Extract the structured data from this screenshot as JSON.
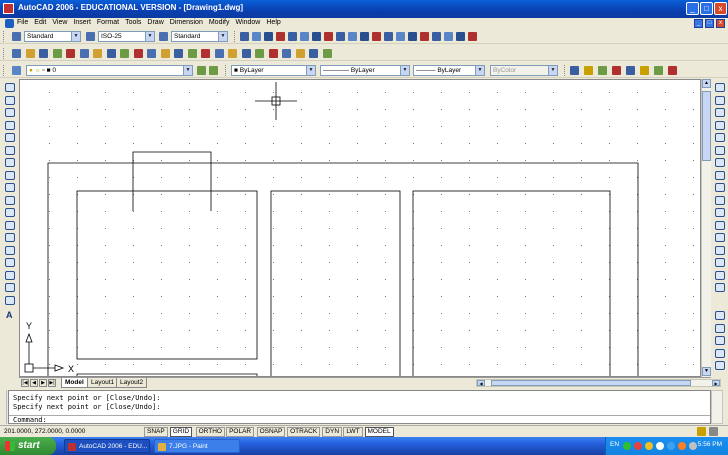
{
  "window": {
    "title": "AutoCAD 2006 - EDUCATIONAL VERSION - [Drawing1.dwg]",
    "min_label": "_",
    "max_label": "□",
    "close_label": "x"
  },
  "menu": {
    "items": [
      "File",
      "Edit",
      "View",
      "Insert",
      "Format",
      "Tools",
      "Draw",
      "Dimension",
      "Modify",
      "Window",
      "Help"
    ]
  },
  "styles_toolbar": {
    "text_style": "Standard",
    "dim_style": "ISO-25",
    "table_style": "Standard"
  },
  "layers_toolbar": {
    "layer": "0",
    "color": "ByLayer",
    "linetype": "ByLayer",
    "lineweight": "ByLayer",
    "plotstyle": "ByColor"
  },
  "ucs": {
    "x_label": "X",
    "y_label": "Y"
  },
  "layout_tabs": [
    {
      "label": "Model",
      "active": true
    },
    {
      "label": "Layout1",
      "active": false
    },
    {
      "label": "Layout2",
      "active": false
    }
  ],
  "command": {
    "lines": [
      "Specify next point or [Close/Undo]:",
      "Specify next point or [Close/Undo]:"
    ],
    "prompt": "Command:"
  },
  "status": {
    "coords": "201.0000, 272.0000, 0.0000",
    "toggles": [
      {
        "label": "SNAP",
        "on": false
      },
      {
        "label": "GRID",
        "on": true
      },
      {
        "label": "ORTHO",
        "on": false
      },
      {
        "label": "POLAR",
        "on": false
      },
      {
        "label": "OSNAP",
        "on": false
      },
      {
        "label": "OTRACK",
        "on": false
      },
      {
        "label": "DYN",
        "on": false
      },
      {
        "label": "LWT",
        "on": false
      },
      {
        "label": "MODEL",
        "on": true
      }
    ]
  },
  "taskbar": {
    "start_label": "start",
    "items": [
      {
        "label": "AutoCAD 2006 - EDU...",
        "active": true
      },
      {
        "label": "7.JPG - Paint",
        "active": false
      }
    ],
    "lang": "EN",
    "clock": "5:56 PM"
  },
  "colors": {
    "title_blue": "#0a3fb0",
    "drawing_bg": "#ffffff",
    "start_green": "#3c9a3c",
    "taskbar_blue": "#245edb"
  }
}
